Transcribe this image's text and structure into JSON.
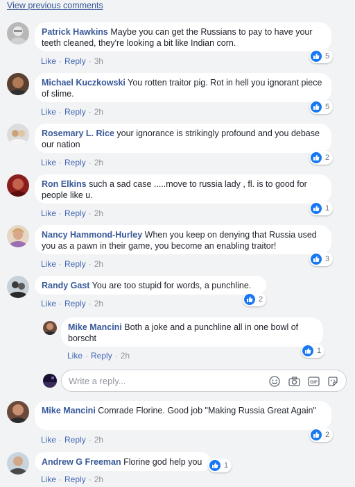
{
  "view_previous": "View previous comments",
  "actions": {
    "like": "Like",
    "reply": "Reply"
  },
  "comments": [
    {
      "author": "Patrick Hawkins",
      "text": "Maybe you can get the Russians to pay to have your teeth cleaned, they're looking a bit like Indian corn.",
      "time": "3h",
      "likes": "5"
    },
    {
      "author": "Michael Kuczkowski",
      "text": "You rotten traitor pig. Rot in hell you ignorant piece of slime.",
      "time": "2h",
      "likes": "5"
    },
    {
      "author": "Rosemary L. Rice",
      "text": "your ignorance is strikingly profound and you debase our nation",
      "time": "2h",
      "likes": "2"
    },
    {
      "author": "Ron Elkins",
      "text": "such a sad case .....move to russia lady , fl. is to good for people like u.",
      "time": "2h",
      "likes": "1"
    },
    {
      "author": "Nancy Hammond-Hurley",
      "text": "When you keep on denying that Russia used you as a pawn in their game, you become an enabling traitor!",
      "time": "2h",
      "likes": "3"
    },
    {
      "author": "Randy Gast",
      "text": "You are too stupid for words, a punchline.",
      "time": "2h",
      "likes": "2"
    },
    {
      "author": "Mike Mancini",
      "text": "Both a joke and a punchline all in one bowl of borscht",
      "time": "2h",
      "likes": "1"
    },
    {
      "author": "Mike Mancini",
      "text": "Comrade Florine. Good job \"Making Russia Great Again\"",
      "time": "2h",
      "likes": "2"
    },
    {
      "author": "Andrew G Freeman",
      "text": "Florine god help you",
      "time": "2h",
      "likes": "1"
    }
  ],
  "reply_box": {
    "placeholder": "Write a reply..."
  },
  "icons": {
    "like": "thumbs-up-icon",
    "emoji": "smiley-icon",
    "camera": "camera-icon",
    "gif": "gif-icon",
    "sticker": "sticker-icon"
  },
  "colors": {
    "link": "#385898",
    "like_blue": "#1877f2",
    "background": "#f2f3f5"
  }
}
